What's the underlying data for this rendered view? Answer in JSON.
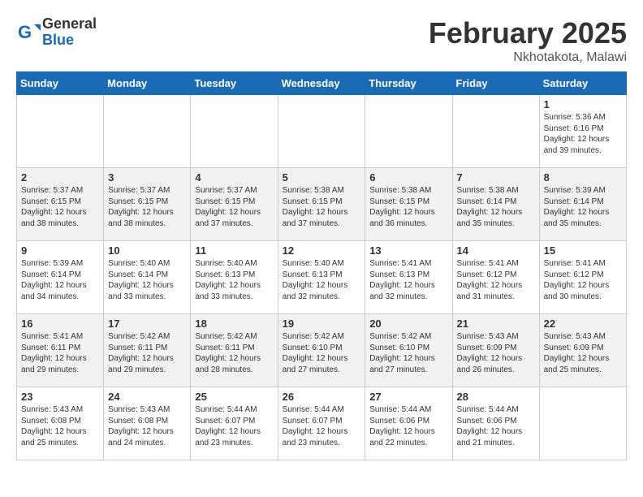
{
  "header": {
    "logo_general": "General",
    "logo_blue": "Blue",
    "month_title": "February 2025",
    "location": "Nkhotakota, Malawi"
  },
  "days_of_week": [
    "Sunday",
    "Monday",
    "Tuesday",
    "Wednesday",
    "Thursday",
    "Friday",
    "Saturday"
  ],
  "weeks": [
    {
      "days": [
        {
          "num": "",
          "content": ""
        },
        {
          "num": "",
          "content": ""
        },
        {
          "num": "",
          "content": ""
        },
        {
          "num": "",
          "content": ""
        },
        {
          "num": "",
          "content": ""
        },
        {
          "num": "",
          "content": ""
        },
        {
          "num": "1",
          "content": "Sunrise: 5:36 AM\nSunset: 6:16 PM\nDaylight: 12 hours and 39 minutes."
        }
      ]
    },
    {
      "days": [
        {
          "num": "2",
          "content": "Sunrise: 5:37 AM\nSunset: 6:15 PM\nDaylight: 12 hours and 38 minutes."
        },
        {
          "num": "3",
          "content": "Sunrise: 5:37 AM\nSunset: 6:15 PM\nDaylight: 12 hours and 38 minutes."
        },
        {
          "num": "4",
          "content": "Sunrise: 5:37 AM\nSunset: 6:15 PM\nDaylight: 12 hours and 37 minutes."
        },
        {
          "num": "5",
          "content": "Sunrise: 5:38 AM\nSunset: 6:15 PM\nDaylight: 12 hours and 37 minutes."
        },
        {
          "num": "6",
          "content": "Sunrise: 5:38 AM\nSunset: 6:15 PM\nDaylight: 12 hours and 36 minutes."
        },
        {
          "num": "7",
          "content": "Sunrise: 5:38 AM\nSunset: 6:14 PM\nDaylight: 12 hours and 35 minutes."
        },
        {
          "num": "8",
          "content": "Sunrise: 5:39 AM\nSunset: 6:14 PM\nDaylight: 12 hours and 35 minutes."
        }
      ]
    },
    {
      "days": [
        {
          "num": "9",
          "content": "Sunrise: 5:39 AM\nSunset: 6:14 PM\nDaylight: 12 hours and 34 minutes."
        },
        {
          "num": "10",
          "content": "Sunrise: 5:40 AM\nSunset: 6:14 PM\nDaylight: 12 hours and 33 minutes."
        },
        {
          "num": "11",
          "content": "Sunrise: 5:40 AM\nSunset: 6:13 PM\nDaylight: 12 hours and 33 minutes."
        },
        {
          "num": "12",
          "content": "Sunrise: 5:40 AM\nSunset: 6:13 PM\nDaylight: 12 hours and 32 minutes."
        },
        {
          "num": "13",
          "content": "Sunrise: 5:41 AM\nSunset: 6:13 PM\nDaylight: 12 hours and 32 minutes."
        },
        {
          "num": "14",
          "content": "Sunrise: 5:41 AM\nSunset: 6:12 PM\nDaylight: 12 hours and 31 minutes."
        },
        {
          "num": "15",
          "content": "Sunrise: 5:41 AM\nSunset: 6:12 PM\nDaylight: 12 hours and 30 minutes."
        }
      ]
    },
    {
      "days": [
        {
          "num": "16",
          "content": "Sunrise: 5:41 AM\nSunset: 6:11 PM\nDaylight: 12 hours and 29 minutes."
        },
        {
          "num": "17",
          "content": "Sunrise: 5:42 AM\nSunset: 6:11 PM\nDaylight: 12 hours and 29 minutes."
        },
        {
          "num": "18",
          "content": "Sunrise: 5:42 AM\nSunset: 6:11 PM\nDaylight: 12 hours and 28 minutes."
        },
        {
          "num": "19",
          "content": "Sunrise: 5:42 AM\nSunset: 6:10 PM\nDaylight: 12 hours and 27 minutes."
        },
        {
          "num": "20",
          "content": "Sunrise: 5:42 AM\nSunset: 6:10 PM\nDaylight: 12 hours and 27 minutes."
        },
        {
          "num": "21",
          "content": "Sunrise: 5:43 AM\nSunset: 6:09 PM\nDaylight: 12 hours and 26 minutes."
        },
        {
          "num": "22",
          "content": "Sunrise: 5:43 AM\nSunset: 6:09 PM\nDaylight: 12 hours and 25 minutes."
        }
      ]
    },
    {
      "days": [
        {
          "num": "23",
          "content": "Sunrise: 5:43 AM\nSunset: 6:08 PM\nDaylight: 12 hours and 25 minutes."
        },
        {
          "num": "24",
          "content": "Sunrise: 5:43 AM\nSunset: 6:08 PM\nDaylight: 12 hours and 24 minutes."
        },
        {
          "num": "25",
          "content": "Sunrise: 5:44 AM\nSunset: 6:07 PM\nDaylight: 12 hours and 23 minutes."
        },
        {
          "num": "26",
          "content": "Sunrise: 5:44 AM\nSunset: 6:07 PM\nDaylight: 12 hours and 23 minutes."
        },
        {
          "num": "27",
          "content": "Sunrise: 5:44 AM\nSunset: 6:06 PM\nDaylight: 12 hours and 22 minutes."
        },
        {
          "num": "28",
          "content": "Sunrise: 5:44 AM\nSunset: 6:06 PM\nDaylight: 12 hours and 21 minutes."
        },
        {
          "num": "",
          "content": ""
        }
      ]
    }
  ]
}
